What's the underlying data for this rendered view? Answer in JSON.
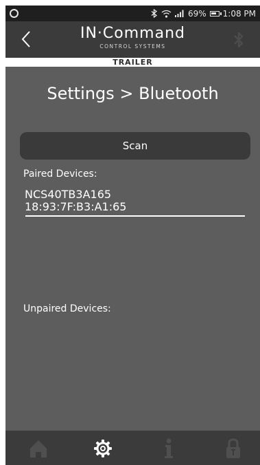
{
  "status_bar": {
    "battery_percent": "69%",
    "time": "1:08 PM",
    "icons": [
      "notification-dot-icon",
      "bluetooth-icon",
      "wifi-icon",
      "cell-signal-icon",
      "battery-icon"
    ]
  },
  "header": {
    "logo_main": "IN·Command",
    "logo_sub": "CONTROL SYSTEMS",
    "back_icon": "chevron-left-icon",
    "bluetooth_icon": "bluetooth-icon"
  },
  "band": {
    "label": "TRAILER"
  },
  "page": {
    "title": "Settings > Bluetooth"
  },
  "scan": {
    "label": "Scan"
  },
  "paired": {
    "label": "Paired Devices:",
    "devices": [
      {
        "name": "NCS40TB3A165",
        "address": "18:93:7F:B3:A1:65"
      }
    ]
  },
  "unpaired": {
    "label": "Unpaired Devices:",
    "devices": []
  },
  "nav": {
    "items": [
      {
        "icon": "home-icon",
        "active": false
      },
      {
        "icon": "gear-icon",
        "active": true
      },
      {
        "icon": "info-icon",
        "active": false
      },
      {
        "icon": "lock-icon",
        "active": false
      }
    ]
  },
  "colors": {
    "background": "#5d5d5d",
    "header": "#3b3b3b",
    "status_bar": "#1f1f1f",
    "button": "#3a3a3a",
    "text": "#ffffff",
    "inactive_icon": "#4f4f4f"
  }
}
